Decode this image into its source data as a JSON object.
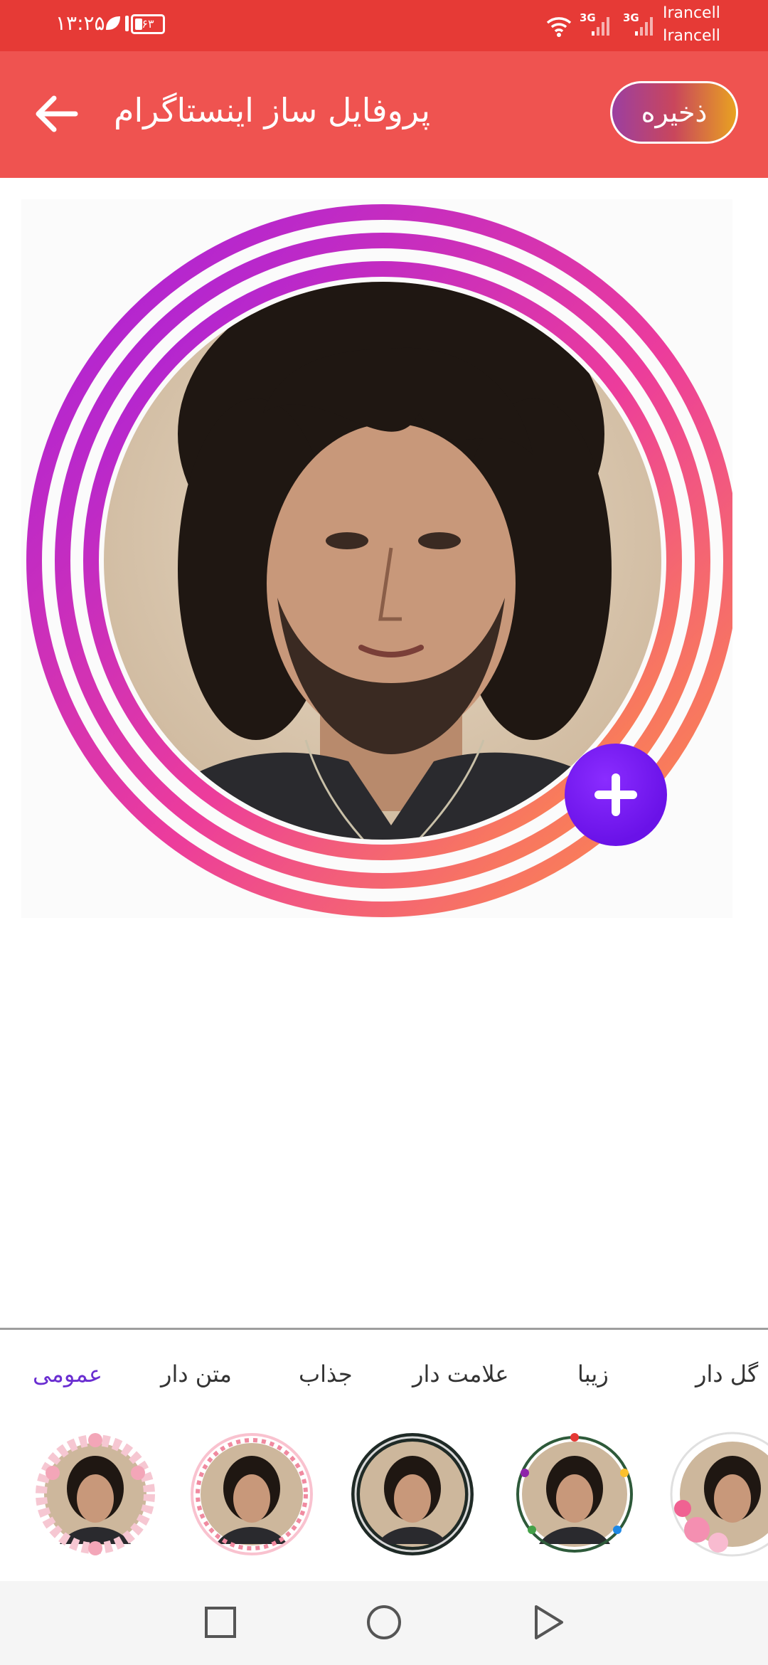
{
  "status_bar": {
    "time": "۱۳:۲۵",
    "battery": "۶۳",
    "network_1": "3G",
    "network_2": "3G",
    "carrier_1": "Irancell",
    "carrier_2": "Irancell"
  },
  "app_bar": {
    "title": "پروفایل ساز اینستاگرام",
    "save_label": "ذخیره",
    "back_icon": "arrow-left-icon"
  },
  "preview": {
    "ring_colors": [
      "#b126e6",
      "#e94ba0",
      "#ff7f50"
    ],
    "add_icon": "plus-icon"
  },
  "tabs": [
    {
      "label": "گل دار",
      "active": false
    },
    {
      "label": "زیبا",
      "active": false
    },
    {
      "label": "علامت دار",
      "active": false
    },
    {
      "label": "جذاب",
      "active": false
    },
    {
      "label": "متن دار",
      "active": false
    },
    {
      "label": "عمومی",
      "active": true
    }
  ],
  "frames": [
    {
      "style": "pink-flower-wreath"
    },
    {
      "style": "heart-border"
    },
    {
      "style": "dark-ring"
    },
    {
      "style": "light-garland"
    },
    {
      "style": "rose-corner"
    }
  ],
  "nav_bar": {
    "recent_icon": "square-icon",
    "home_icon": "circle-icon",
    "back_icon": "triangle-back-icon"
  }
}
